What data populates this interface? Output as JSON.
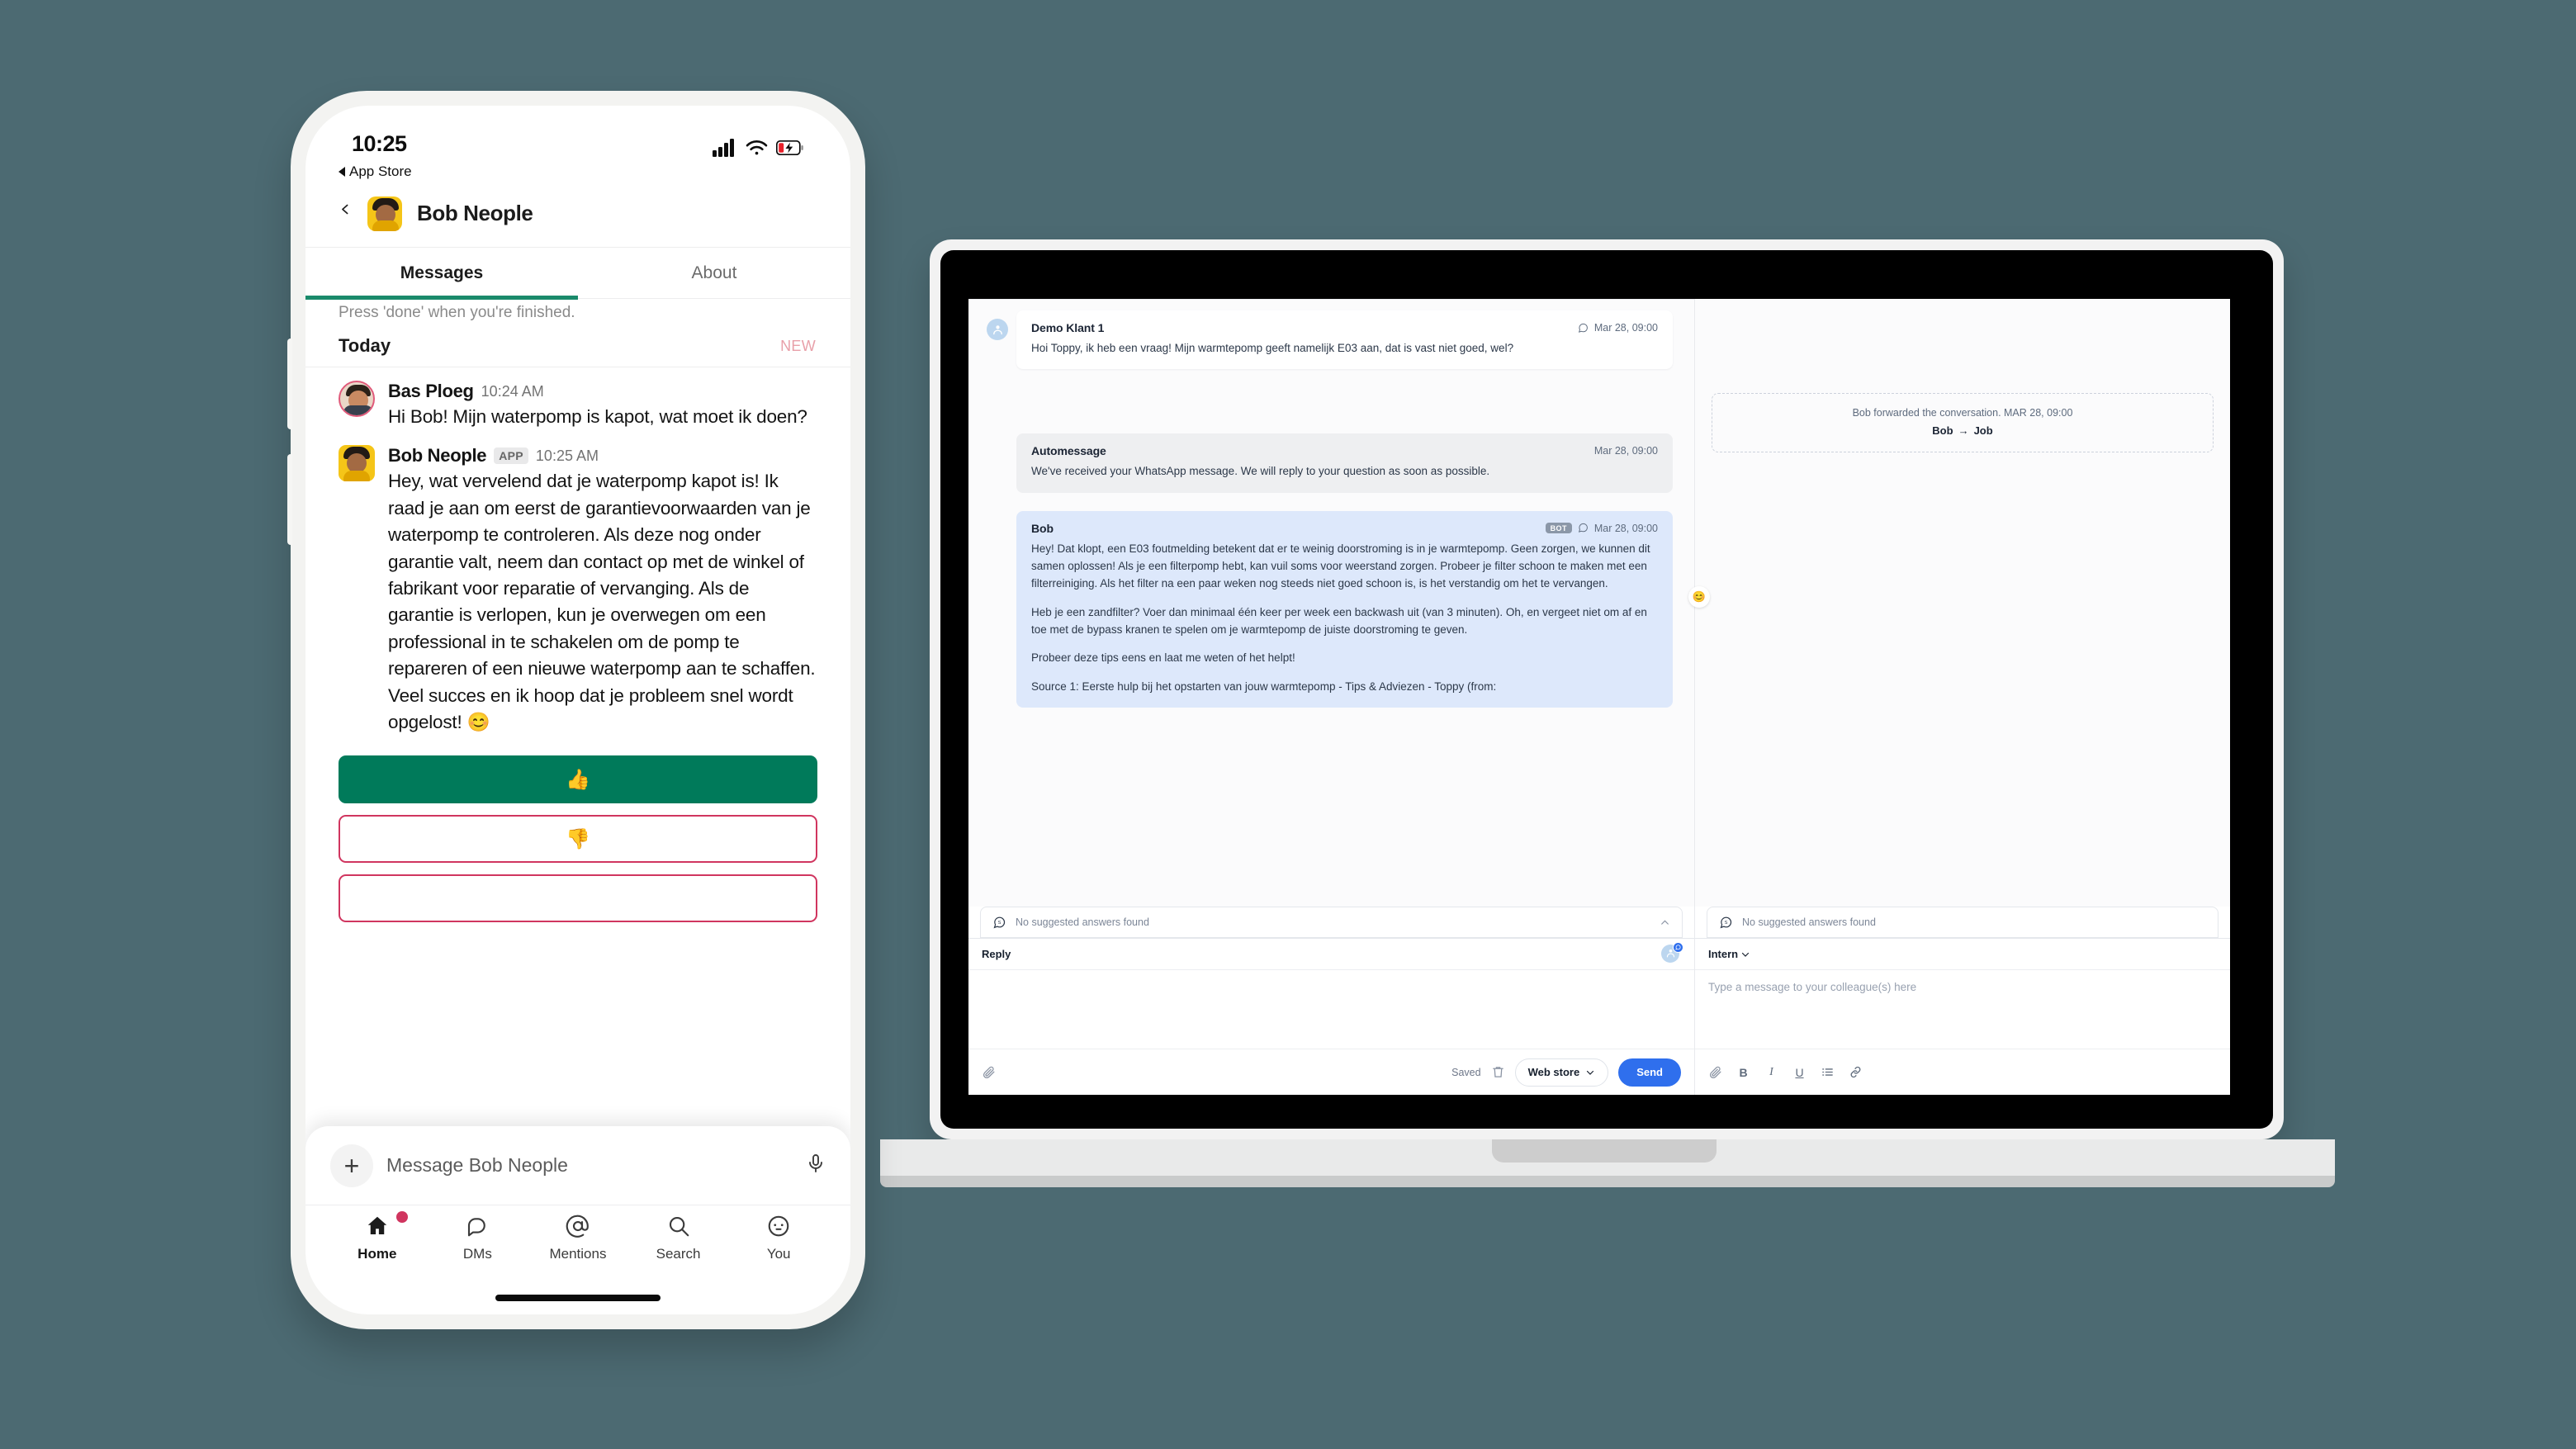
{
  "colors": {
    "background": "#4c6a72",
    "slack_green": "#007a5a",
    "slack_pink": "#d0355f",
    "accent_blue": "#2f6fed",
    "tab_underline": "#1a8a6b",
    "new_badge": "#e8a0a9"
  },
  "phone": {
    "status": {
      "time": "10:25",
      "back_link": "App Store"
    },
    "header": {
      "title": "Bob Neople",
      "back_icon": "chevron-left-icon",
      "avatar": "bob-avatar"
    },
    "tabs": [
      {
        "label": "Messages",
        "active": true
      },
      {
        "label": "About",
        "active": false
      }
    ],
    "hint": "Press 'done' when you're finished.",
    "day_divider": {
      "label": "Today",
      "badge": "NEW"
    },
    "messages": [
      {
        "name": "Bas Ploeg",
        "badge": "",
        "time": "10:24 AM",
        "text": "Hi Bob! Mijn waterpomp is kapot, wat moet ik doen?"
      },
      {
        "name": "Bob Neople",
        "badge": "APP",
        "time": "10:25 AM",
        "text": "Hey, wat vervelend dat je waterpomp kapot is! Ik raad je aan om eerst de garantievoorwaarden van je waterpomp te controleren. Als deze nog onder garantie valt, neem dan contact op met de winkel of fabrikant voor reparatie of vervanging. Als de garantie is verlopen, kun je overwegen om een professional in te schakelen om de pomp te repareren of een nieuwe waterpomp aan te schaffen. Veel succes en ik hoop dat je probleem snel wordt opgelost! 😊"
      }
    ],
    "feedback": {
      "thumbs_up": "👍",
      "thumbs_down": "👎"
    },
    "composer": {
      "placeholder": "Message Bob Neople",
      "plus_icon": "plus-icon",
      "mic_icon": "microphone-icon"
    },
    "tabbar": [
      {
        "label": "Home",
        "icon": "home-icon",
        "active": true,
        "badge": true
      },
      {
        "label": "DMs",
        "icon": "dms-icon",
        "active": false,
        "badge": false
      },
      {
        "label": "Mentions",
        "icon": "at-icon",
        "active": false,
        "badge": false
      },
      {
        "label": "Search",
        "icon": "search-icon",
        "active": false,
        "badge": false
      },
      {
        "label": "You",
        "icon": "you-icon",
        "active": false,
        "badge": false
      }
    ]
  },
  "laptop": {
    "left_panel": {
      "messages": [
        {
          "name": "Demo Klant 1",
          "timestamp": "Mar 28, 09:00",
          "badge": "",
          "style": "white",
          "has_avatar": true,
          "paragraphs": [
            "Hoi Toppy, ik heb een vraag! Mijn warmtepomp geeft namelijk E03 aan, dat is vast niet goed, wel?"
          ]
        },
        {
          "name": "Automessage",
          "timestamp": "Mar 28, 09:00",
          "badge": "",
          "style": "grey",
          "has_avatar": false,
          "paragraphs": [
            "We've received your WhatsApp message. We will reply to your question as soon as possible."
          ]
        },
        {
          "name": "Bob",
          "timestamp": "Mar 28, 09:00",
          "badge": "BOT",
          "style": "blue",
          "has_avatar": false,
          "paragraphs": [
            "Hey! Dat klopt, een E03 foutmelding betekent dat er te weinig doorstroming is in je warmtepomp. Geen zorgen, we kunnen dit samen oplossen! Als je een filterpomp hebt, kan vuil soms voor weerstand zorgen. Probeer je filter schoon te maken met een filterreiniging. Als het filter na een paar weken nog steeds niet goed schoon is, is het verstandig om het te vervangen.",
            "Heb je een zandfilter? Voer dan minimaal één keer per week een backwash uit (van 3 minuten). Oh, en vergeet niet om af en toe met de bypass kranen te spelen om je warmtepomp de juiste doorstroming te geven.",
            "Probeer deze tips eens en laat me weten of het helpt!"
          ],
          "source_label": "Source 1: Eerste hulp bij het opstarten van jouw warmtepomp - Tips & Adviezen - Toppy (from:"
        }
      ],
      "reaction_emoji": "😊",
      "suggested": {
        "text": "No suggested answers found",
        "icon": "suggested-answers-icon",
        "collapse_icon": "chevron-up-icon"
      },
      "composer": {
        "title": "Reply",
        "attach_icon": "paperclip-icon",
        "saved_label": "Saved",
        "trash_icon": "trash-icon",
        "channel_label": "Web store",
        "channel_chevron": "chevron-down-icon",
        "send_label": "Send"
      }
    },
    "right_panel": {
      "forwarded": {
        "note": "Bob forwarded the conversation. MAR 28, 09:00",
        "from": "Bob",
        "arrow": "→",
        "to": "Job"
      },
      "suggested": {
        "text": "No suggested answers found",
        "icon": "suggested-answers-icon"
      },
      "composer": {
        "title": "Intern",
        "chevron": "chevron-down-icon",
        "placeholder": "Type a message to your colleague(s) here",
        "toolbar": [
          {
            "icon": "paperclip-icon",
            "label": ""
          },
          {
            "icon": "bold-icon",
            "label": "B"
          },
          {
            "icon": "italic-icon",
            "label": "I"
          },
          {
            "icon": "underline-icon",
            "label": "U"
          },
          {
            "icon": "list-icon",
            "label": "☰"
          },
          {
            "icon": "link-icon",
            "label": "🔗"
          }
        ]
      }
    }
  }
}
